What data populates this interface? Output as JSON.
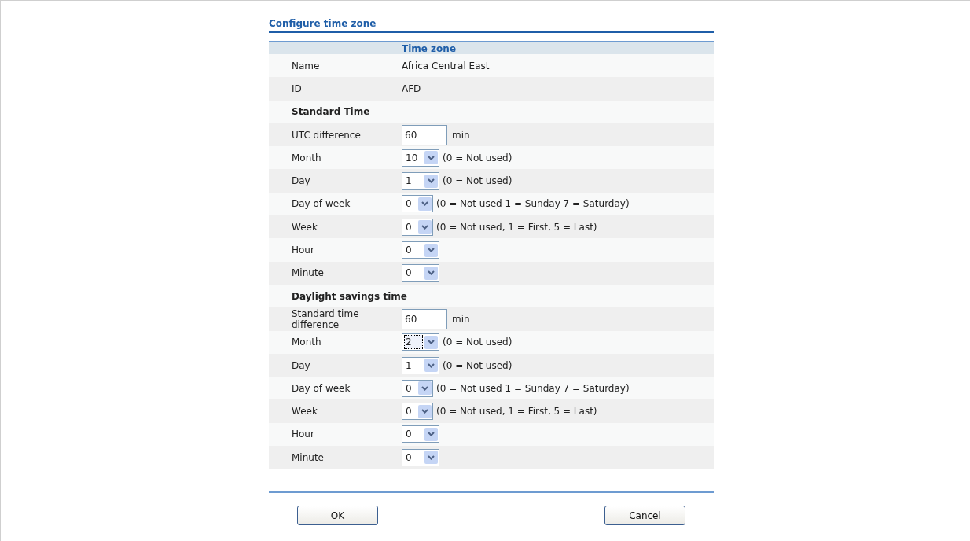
{
  "title": "Configure time zone",
  "table": {
    "header": "Time zone",
    "rows": [
      {
        "kind": "text",
        "label": "Name",
        "value": "Africa Central East"
      },
      {
        "kind": "text",
        "label": "ID",
        "value": "AFD"
      },
      {
        "kind": "heading",
        "label": "Standard Time"
      },
      {
        "kind": "input",
        "label": "UTC difference",
        "value": "60",
        "unit": "min"
      },
      {
        "kind": "select",
        "label": "Month",
        "value": "10",
        "note": "(0 = Not used)",
        "focused": false
      },
      {
        "kind": "select",
        "label": "Day",
        "value": "1",
        "note": "(0 = Not used)",
        "focused": false
      },
      {
        "kind": "compact",
        "label": "Day of week",
        "value": "0",
        "note": "(0 = Not used 1 = Sunday 7 = Saturday)",
        "focused": false
      },
      {
        "kind": "compact",
        "label": "Week",
        "value": "0",
        "note": "(0 = Not used, 1 = First, 5 = Last)",
        "focused": false
      },
      {
        "kind": "select",
        "label": "Hour",
        "value": "0",
        "focused": false
      },
      {
        "kind": "select",
        "label": "Minute",
        "value": "0",
        "focused": false
      },
      {
        "kind": "heading",
        "label": "Daylight savings time"
      },
      {
        "kind": "input",
        "label": "Standard time difference",
        "value": "60",
        "unit": "min"
      },
      {
        "kind": "select",
        "label": "Month",
        "value": "2",
        "note": "(0 = Not used)",
        "focused": true
      },
      {
        "kind": "select",
        "label": "Day",
        "value": "1",
        "note": "(0 = Not used)",
        "focused": false
      },
      {
        "kind": "compact",
        "label": "Day of week",
        "value": "0",
        "note": "(0 = Not used 1 = Sunday 7 = Saturday)",
        "focused": false
      },
      {
        "kind": "compact",
        "label": "Week",
        "value": "0",
        "note": "(0 = Not used, 1 = First, 5 = Last)",
        "focused": false
      },
      {
        "kind": "select",
        "label": "Hour",
        "value": "0",
        "focused": false
      },
      {
        "kind": "select",
        "label": "Minute",
        "value": "0",
        "focused": false
      }
    ]
  },
  "buttons": [
    "OK",
    "Cancel"
  ]
}
